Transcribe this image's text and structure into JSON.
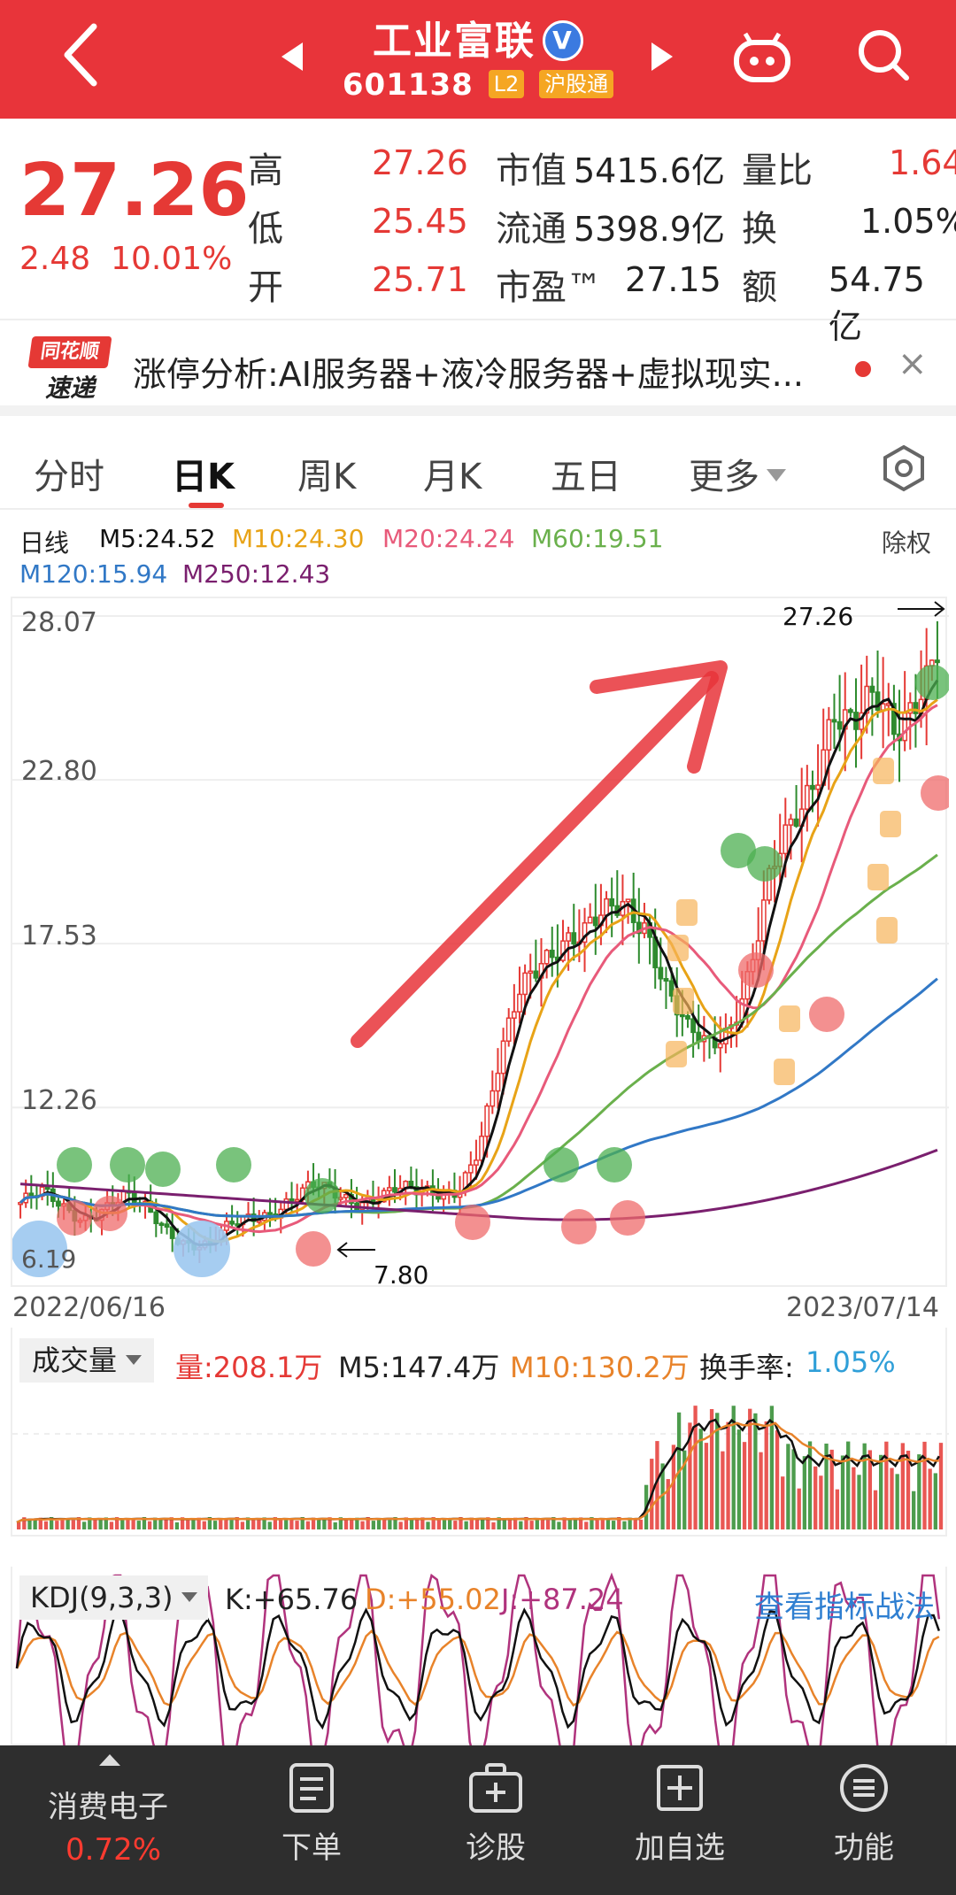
{
  "header": {
    "title": "工业富联",
    "verified": "V",
    "code": "601138",
    "tags": [
      "L2",
      "沪股通"
    ]
  },
  "quote": {
    "price": "27.26",
    "change": "2.48",
    "change_pct": "10.01%",
    "rows": [
      {
        "l1": "高",
        "v1": "27.26",
        "l2": "市值",
        "v2": "5415.6亿",
        "l3": "量比",
        "v3": "1.64"
      },
      {
        "l1": "低",
        "v1": "25.45",
        "l2": "流通",
        "v2": "5398.9亿",
        "l3": "换",
        "v3": "1.05%"
      },
      {
        "l1": "开",
        "v1": "25.71",
        "l2": "市盈™",
        "v2": "27.15",
        "l3": "额",
        "v3": "54.75亿"
      }
    ]
  },
  "news": {
    "logo_top": "同花顺",
    "logo_bottom": "速递",
    "text": "涨停分析:AI服务器+液冷服务器+虚拟现实...",
    "close": "×"
  },
  "tabs": [
    "分时",
    "日K",
    "周K",
    "月K",
    "五日",
    "更多"
  ],
  "ma": {
    "label": "日线",
    "m5": "M5:24.52",
    "m10": "M10:24.30",
    "m20": "M20:24.24",
    "m60": "M60:19.51",
    "m120": "M120:15.94",
    "m250": "M250:12.43",
    "adjust": "除权"
  },
  "colors": {
    "brand": "#e8343a",
    "up": "#e53935",
    "down": "#2e8b2e",
    "m5": "#111111",
    "m10": "#e8a317",
    "m20": "#e85a7a",
    "m60": "#6ab04c",
    "m120": "#3178c6",
    "m250": "#7a1f6e"
  },
  "chart_data": {
    "type": "line",
    "title": "",
    "yticks": [
      "28.07",
      "22.80",
      "17.53",
      "12.26"
    ],
    "ylim": [
      7.0,
      28.07
    ],
    "x_start": "2022/06/16",
    "x_end": "2023/07/14",
    "annotations": {
      "high": "27.26",
      "low": "7.80",
      "left": "6.19"
    },
    "grid": true,
    "legend": "top-left",
    "close_trend": [
      9.2,
      9.4,
      9.0,
      8.8,
      9.1,
      9.3,
      8.9,
      8.4,
      8.0,
      7.8,
      8.3,
      8.7,
      9.0,
      9.4,
      9.6,
      9.4,
      9.3,
      9.5,
      9.6,
      9.4,
      9.5,
      9.8,
      11.0,
      13.5,
      16.0,
      17.3,
      17.8,
      17.6,
      18.2,
      19.0,
      18.4,
      16.0,
      14.5,
      14.2,
      15.0,
      16.8,
      19.5,
      21.0,
      22.8,
      25.5,
      24.5,
      25.0,
      24.3,
      26.0,
      27.26
    ]
  },
  "volume": {
    "selector": "成交量",
    "vol": "量:208.1万",
    "m5": "M5:147.4万",
    "m10": "M10:130.2万",
    "turnover_label": "换手率:",
    "turnover": "1.05%"
  },
  "kdj": {
    "selector": "KDJ(9,3,3)",
    "k": "K:+65.76",
    "d": "D:+55.02",
    "j": "J:+87.24",
    "link": "查看指标战法"
  },
  "bottom": {
    "sector": "消费电子",
    "sector_pct": "0.72%",
    "buttons": [
      "下单",
      "诊股",
      "加自选",
      "功能"
    ]
  }
}
